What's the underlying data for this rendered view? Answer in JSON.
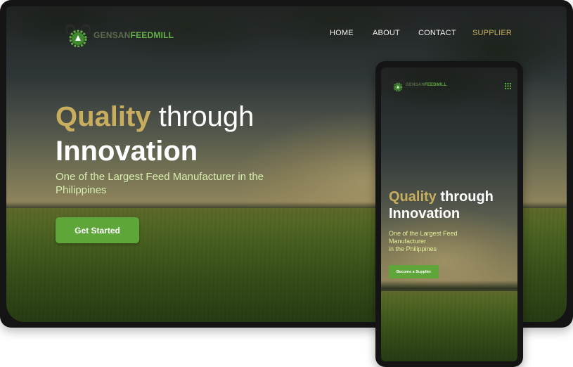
{
  "brand": {
    "name_part1": "GENSAN",
    "name_part2": "FEEDMILL",
    "logo_icon": "gear-chicken-logo-icon",
    "primary_green": "#5ea53a",
    "accent_gold": "#c9ad5f"
  },
  "nav": {
    "items": [
      {
        "label": "HOME",
        "active": false
      },
      {
        "label": "ABOUT",
        "active": false
      },
      {
        "label": "CONTACT",
        "active": false
      },
      {
        "label": "SUPPLIER",
        "active": true
      }
    ]
  },
  "hero": {
    "title_accent": "Quality",
    "title_rest": " through",
    "title_line2": "Innovation",
    "subtitle": "One of the Largest Feed Manufacturer in the Philippines",
    "cta_label": "Get Started"
  },
  "mobile": {
    "menu_icon": "grid-menu-icon",
    "subtitle_line1": "One of the Largest Feed",
    "subtitle_line2": "Manufacturer",
    "subtitle_line3": "in the Philippines",
    "cta_label": "Become a Supplier"
  }
}
